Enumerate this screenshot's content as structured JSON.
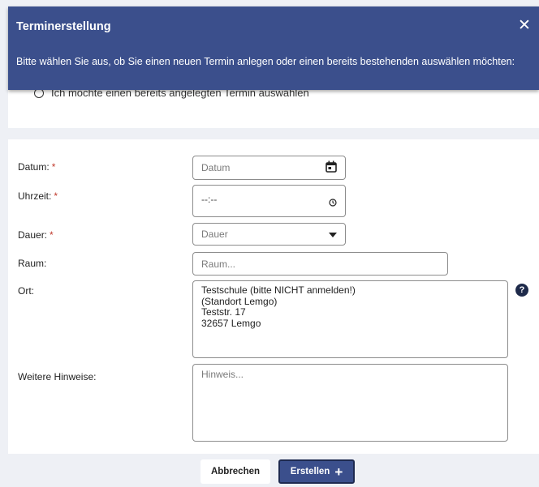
{
  "dialog": {
    "title": "Terminerstellung",
    "close_symbol": "✕",
    "description": "Bitte wählen Sie aus, ob Sie einen neuen Termin anlegen oder einen bereits bestehenden auswählen möchten:",
    "radio_option_existing": "Ich möchte einen bereits angelegten Termin auswählen"
  },
  "form": {
    "datum": {
      "label": "Datum:",
      "required_mark": "*",
      "placeholder": "Datum",
      "icon": "calendar-icon"
    },
    "uhrzeit": {
      "label": "Uhrzeit:",
      "required_mark": "*",
      "value": "--:--",
      "icon": "clock-icon"
    },
    "dauer": {
      "label": "Dauer:",
      "required_mark": "*",
      "placeholder": "Dauer",
      "icon": "caret-down-icon"
    },
    "raum": {
      "label": "Raum:",
      "placeholder": "Raum..."
    },
    "ort": {
      "label": "Ort:",
      "lines": [
        "Testschule (bitte NICHT anmelden!)",
        "(Standort Lemgo)",
        "Teststr. 17",
        "32657 Lemgo"
      ],
      "help_symbol": "?"
    },
    "hinweise": {
      "label": "Weitere Hinweise:",
      "placeholder": "Hinweis..."
    }
  },
  "buttons": {
    "cancel": "Abbrechen",
    "create": "Erstellen",
    "create_icon": "+"
  },
  "colors": {
    "header_bg": "#3b4f8c",
    "required": "#c0392b",
    "page_bg": "#eef0f5"
  }
}
